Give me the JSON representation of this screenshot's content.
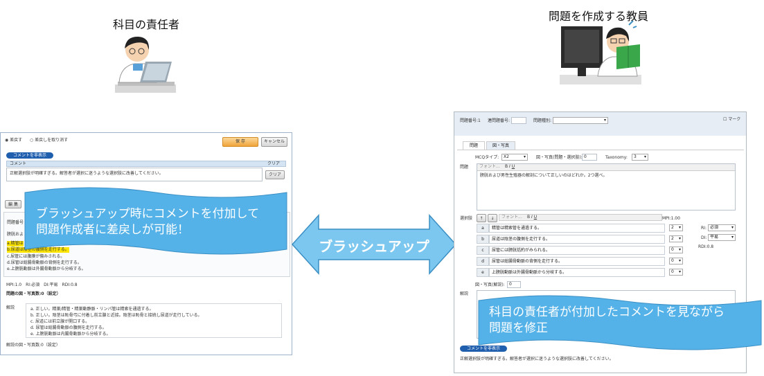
{
  "roles": {
    "left_title": "科目の責任者",
    "right_title": "問題を作成する教員"
  },
  "left_panel": {
    "radio_return": "差戻す",
    "radio_cancel": "差戻しを取り消す",
    "save_button": "保 存",
    "cancel_button": "キャンセル",
    "comment_toggle": "コメントを非表示",
    "comment_header": "コメント",
    "clear_header": "クリア",
    "comment_text": "正解選択肢が明確すぎる。解答者が選択に迷うような選択肢に改善してください。",
    "clear_button": "クリア",
    "tab_edit": "編 集",
    "question_no_label": "問題番号",
    "options": [
      "a.精管は",
      "b.尿道は",
      "c.尿管には腹膜が傷みされる。",
      "d.尿管は総腸骨動脈の背側を走行する。",
      "e.上膀胱動脈は外腸骨動脈から分岐する。"
    ],
    "stats": "MPI:1.0　RI:必須　DI:平易　RDI:0.8",
    "question_images": "問題の図・写真数:0（設定）",
    "explanation_label": "解説",
    "explanation_lines": [
      "a. 正しい。精巣/精管・精巣動静脈・リンパ管は精索を通過する。",
      "b. 正しい。陰茎は恥骨弓に付着し前立腺と近接。陰茎は恥骨と接続し尿道が走行している。",
      "c. 尿道には前立腺が開口する。",
      "d. 尿管は総腸骨動脈の腹側を走行する。",
      "e. 上膀胱動脈は内腸骨動脈から分岐する。"
    ],
    "explanation_images": "解説の図・写真数:0（設定）"
  },
  "left_callout": "ブラッシュアップ時にコメントを付加して\n問題作成者に差戻しが可能！",
  "center_arrow_label": "ブラッシュアップ",
  "right_panel": {
    "question_no": "問題番号:1",
    "linked_no_label": "連問題番号:",
    "question_type_label": "問題種別:",
    "mark_label": "マーク",
    "tab_question": "問題",
    "tab_figure": "図・写真",
    "mcq_type_label": "MCQタイプ:",
    "mcq_type_value": "X2",
    "figure_count_label": "図・写真(問題・選択肢):",
    "figure_count_value": "0",
    "taxonomy_label": "Taxonomy:",
    "taxonomy_value": "3",
    "question_label": "問題",
    "font_placeholder": "フォント...",
    "question_text": "膀胱および男性生殖器の解剖について正しいのはどれか。2つ選べ。",
    "choices_label": "選択肢",
    "mpi_label": "MPI:1.00",
    "choices": [
      {
        "key": "a",
        "text": "精管は精索管を通過する。",
        "score": "2"
      },
      {
        "key": "b",
        "text": "尿道は陰茎の腹側を走行する。",
        "score": "2"
      },
      {
        "key": "c",
        "text": "尿管には膀胱括約がみられる。",
        "score": "0"
      },
      {
        "key": "d",
        "text": "尿管は総腸骨動脈の背側を走行する。",
        "score": "0"
      },
      {
        "key": "e",
        "text": "上膀胱動脈は外腸骨動脈から分岐する。",
        "score": "0"
      }
    ],
    "ri_label": "RI:",
    "ri_value": "必須",
    "di_label": "DI:",
    "di_value": "平易",
    "rdi": "RDI:0.8",
    "explain_figure_label": "図・写真(解説):",
    "explain_figure_value": "0",
    "explanation_label": "解説",
    "comment_toggle": "コメントを非表示",
    "comment_text": "正解選択肢が明確すぎる。解答者が選択に迷うような選択肢に改善してください。"
  },
  "right_callout": "科目の責任者が付加したコメントを見ながら\n問題を修正",
  "colors": {
    "callout_fill": "#55b2e8",
    "arrow_fill": "#7cc7ef",
    "pill_blue": "#1f5fae",
    "save_orange": "#f0a43a",
    "highlight_yellow": "#ffe600"
  }
}
